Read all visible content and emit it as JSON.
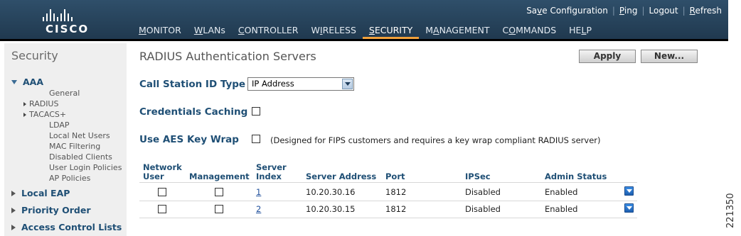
{
  "header": {
    "logo_text": "CISCO",
    "utility_links": [
      {
        "pre": "Sa",
        "ul": "v",
        "post": "e Configuration"
      },
      {
        "pre": "",
        "ul": "P",
        "post": "ing"
      },
      {
        "pre": "Lo",
        "ul": "g",
        "post": "out"
      },
      {
        "pre": "",
        "ul": "R",
        "post": "efresh"
      }
    ],
    "menu": [
      {
        "pre": "",
        "ul": "M",
        "post": "ONITOR"
      },
      {
        "pre": "",
        "ul": "W",
        "post": "LANs"
      },
      {
        "pre": "",
        "ul": "C",
        "post": "ONTROLLER"
      },
      {
        "pre": "W",
        "ul": "I",
        "post": "RELESS"
      },
      {
        "pre": "",
        "ul": "S",
        "post": "ECURITY"
      },
      {
        "pre": "M",
        "ul": "A",
        "post": "NAGEMENT"
      },
      {
        "pre": "C",
        "ul": "O",
        "post": "MMANDS"
      },
      {
        "pre": "HE",
        "ul": "L",
        "post": "P"
      }
    ]
  },
  "sidebar": {
    "title": "Security",
    "aaa": "AAA",
    "aaa_items": [
      "General",
      "RADIUS",
      "TACACS+",
      "LDAP",
      "Local Net Users",
      "MAC Filtering",
      "Disabled Clients",
      "User Login Policies",
      "AP Policies"
    ],
    "sections": [
      "Local EAP",
      "Priority Order",
      "Access Control Lists"
    ]
  },
  "main": {
    "title": "RADIUS Authentication Servers",
    "apply_label": "Apply",
    "new_label": "New...",
    "call_station_label": "Call Station ID Type",
    "call_station_value": "IP Address",
    "credentials_caching_label": "Credentials Caching",
    "aes_key_wrap_label": "Use AES Key Wrap",
    "aes_note": "(Designed for FIPS customers and requires a key wrap compliant RADIUS server)"
  },
  "table": {
    "headers": {
      "network_user_1": "Network",
      "network_user_2": "User",
      "management": "Management",
      "server_index_1": "Server",
      "server_index_2": "Index",
      "server_address": "Server Address",
      "port": "Port",
      "ipsec": "IPSec",
      "admin_status": "Admin Status"
    },
    "rows": [
      {
        "index": "1",
        "address": "10.20.30.16",
        "port": "1812",
        "ipsec": "Disabled",
        "admin_status": "Enabled"
      },
      {
        "index": "2",
        "address": "10.20.30.15",
        "port": "1812",
        "ipsec": "Disabled",
        "admin_status": "Enabled"
      }
    ]
  },
  "figure_id": "221350"
}
